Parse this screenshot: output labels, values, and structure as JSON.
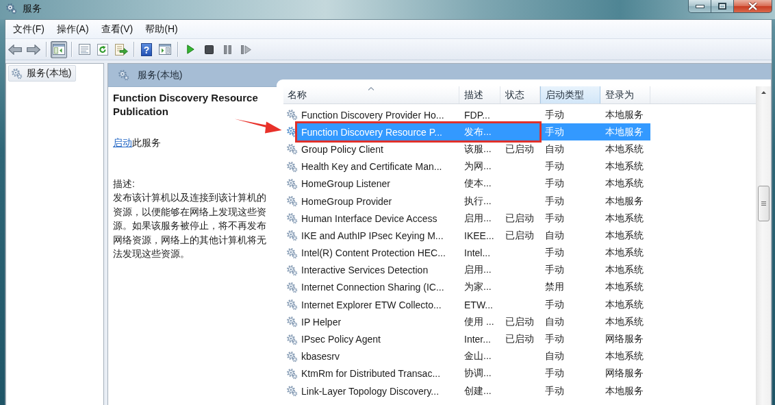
{
  "window": {
    "title": "服务"
  },
  "menu": [
    {
      "label": "文件(F)"
    },
    {
      "label": "操作(A)"
    },
    {
      "label": "查看(V)"
    },
    {
      "label": "帮助(H)"
    }
  ],
  "toolbar": [
    [
      {
        "kind": "back",
        "pressed": false
      },
      {
        "kind": "forward",
        "pressed": false
      }
    ],
    [
      {
        "kind": "console_tree",
        "pressed": true
      }
    ],
    [
      {
        "kind": "properties",
        "pressed": false
      },
      {
        "kind": "refresh",
        "pressed": false
      },
      {
        "kind": "export",
        "pressed": false
      }
    ],
    [
      {
        "kind": "help",
        "glyph": "?",
        "pressed": false
      },
      {
        "kind": "action_pane",
        "pressed": false
      }
    ],
    [
      {
        "kind": "start",
        "pressed": false
      },
      {
        "kind": "stop",
        "pressed": false
      },
      {
        "kind": "pause",
        "pressed": false
      },
      {
        "kind": "resume",
        "pressed": false
      }
    ]
  ],
  "tree": {
    "items": [
      {
        "label": "服务(本地)",
        "selected": true
      }
    ]
  },
  "pane_header": {
    "title": "服务(本地)"
  },
  "details": {
    "title": "Function Discovery Resource Publication",
    "action_link": "启动",
    "action_text": "此服务",
    "description_label": "描述:",
    "description": "发布该计算机以及连接到该计算机的资源，以便能够在网络上发现这些资源。如果该服务被停止，将不再发布网络资源，网络上的其他计算机将无法发现这些资源。"
  },
  "table": {
    "columns": [
      {
        "label": "名称",
        "sorted": true,
        "hovered": false
      },
      {
        "label": "描述",
        "sorted": false,
        "hovered": false
      },
      {
        "label": "状态",
        "sorted": false,
        "hovered": false
      },
      {
        "label": "启动类型",
        "sorted": false,
        "hovered": true
      },
      {
        "label": "登录为",
        "sorted": false,
        "hovered": false
      }
    ],
    "rows": [
      {
        "name": "Function Discovery Provider Ho...",
        "description": "FDP...",
        "startup_type": "手动",
        "log_on_as": "本地服务",
        "selected": false,
        "annotated": false
      },
      {
        "name": "Function Discovery Resource P...",
        "description": "发布...",
        "startup_type": "手动",
        "log_on_as": "本地服务",
        "selected": true,
        "annotated": true
      },
      {
        "name": "Group Policy Client",
        "description": "该服...",
        "status": "已启动",
        "startup_type": "自动",
        "log_on_as": "本地系统",
        "selected": false,
        "annotated": false
      },
      {
        "name": "Health Key and Certificate Man...",
        "description": "为网...",
        "startup_type": "手动",
        "log_on_as": "本地系统",
        "selected": false,
        "annotated": false
      },
      {
        "name": "HomeGroup Listener",
        "description": "使本...",
        "startup_type": "手动",
        "log_on_as": "本地系统",
        "selected": false,
        "annotated": false
      },
      {
        "name": "HomeGroup Provider",
        "description": "执行...",
        "startup_type": "手动",
        "log_on_as": "本地服务",
        "selected": false,
        "annotated": false
      },
      {
        "name": "Human Interface Device Access",
        "description": "启用...",
        "status": "已启动",
        "startup_type": "手动",
        "log_on_as": "本地系统",
        "selected": false,
        "annotated": false
      },
      {
        "name": "IKE and AuthIP IPsec Keying M...",
        "description": "IKEE...",
        "status": "已启动",
        "startup_type": "自动",
        "log_on_as": "本地系统",
        "selected": false,
        "annotated": false
      },
      {
        "name": "Intel(R) Content Protection HEC...",
        "description": "Intel...",
        "startup_type": "手动",
        "log_on_as": "本地系统",
        "selected": false,
        "annotated": false
      },
      {
        "name": "Interactive Services Detection",
        "description": "启用...",
        "startup_type": "手动",
        "log_on_as": "本地系统",
        "selected": false,
        "annotated": false
      },
      {
        "name": "Internet Connection Sharing (IC...",
        "description": "为家...",
        "startup_type": "禁用",
        "log_on_as": "本地系统",
        "selected": false,
        "annotated": false
      },
      {
        "name": "Internet Explorer ETW Collecto...",
        "description": "ETW...",
        "startup_type": "手动",
        "log_on_as": "本地系统",
        "selected": false,
        "annotated": false
      },
      {
        "name": "IP Helper",
        "description": "使用 ...",
        "status": "已启动",
        "startup_type": "自动",
        "log_on_as": "本地系统",
        "selected": false,
        "annotated": false
      },
      {
        "name": "IPsec Policy Agent",
        "description": "Inter...",
        "status": "已启动",
        "startup_type": "手动",
        "log_on_as": "网络服务",
        "selected": false,
        "annotated": false
      },
      {
        "name": "kbasesrv",
        "description": "金山...",
        "startup_type": "自动",
        "log_on_as": "本地系统",
        "selected": false,
        "annotated": false
      },
      {
        "name": "KtmRm for Distributed Transac...",
        "description": "协调...",
        "startup_type": "手动",
        "log_on_as": "网络服务",
        "selected": false,
        "annotated": false
      },
      {
        "name": "Link-Layer Topology Discovery...",
        "description": "创建...",
        "startup_type": "手动",
        "log_on_as": "本地服务",
        "selected": false,
        "annotated": false
      }
    ]
  }
}
